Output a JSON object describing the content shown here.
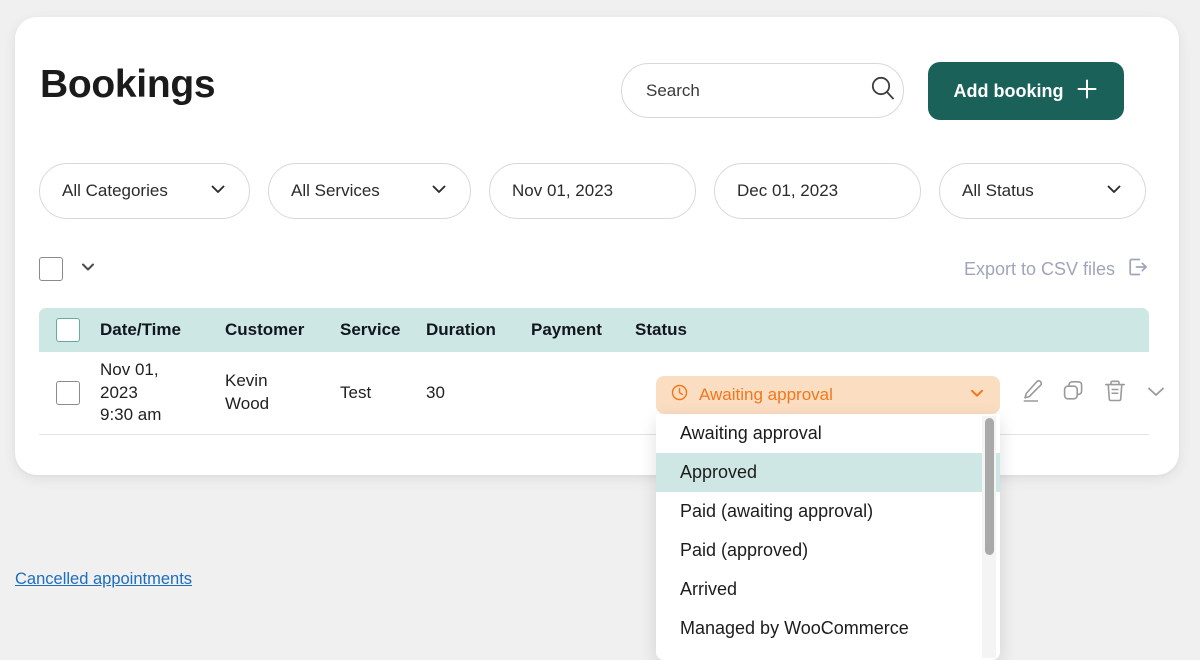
{
  "page": {
    "title": "Bookings",
    "cancelled_link": "Cancelled appointments",
    "accent_teal": "#1a6159",
    "header_bg": "#cce7e4",
    "status_orange": "#f4761a",
    "status_orange_bg": "#fbddc2",
    "link_blue": "#1c6ebd"
  },
  "search": {
    "placeholder": "Search",
    "value": "",
    "icon": "search-icon"
  },
  "toolbar": {
    "add_booking_label": "Add booking",
    "add_booking_icon": "plus-icon",
    "export_label": "Export to CSV files",
    "export_icon": "export-icon"
  },
  "filters": [
    {
      "label": "All Categories",
      "type": "select",
      "has_chevron": true
    },
    {
      "label": "All Services",
      "type": "select",
      "has_chevron": true
    },
    {
      "label": "Nov 01, 2023",
      "type": "date",
      "has_chevron": false
    },
    {
      "label": "Dec 01, 2023",
      "type": "date",
      "has_chevron": false
    },
    {
      "label": "All Status",
      "type": "select",
      "has_chevron": true
    }
  ],
  "table": {
    "columns": [
      "Date/Time",
      "Customer",
      "Service",
      "Duration",
      "Payment",
      "Status"
    ],
    "rows": [
      {
        "datetime": "Nov 01, 2023 9:30 am",
        "date_line1": "Nov 01,",
        "date_line2": "2023",
        "date_line3": "9:30 am",
        "customer_line1": "Kevin",
        "customer_line2": "Wood",
        "customer": "Kevin Wood",
        "service": "Test",
        "duration": "30",
        "payment": "",
        "status": "Awaiting approval",
        "status_icon": "clock-icon"
      }
    ]
  },
  "status_menu": {
    "selected": "Approved",
    "current_value": "Awaiting approval",
    "options": [
      "Awaiting approval",
      "Approved",
      "Paid (awaiting approval)",
      "Paid (approved)",
      "Arrived",
      "Managed by WooCommerce"
    ]
  },
  "row_actions": [
    {
      "name": "edit-icon"
    },
    {
      "name": "duplicate-icon"
    },
    {
      "name": "delete-icon"
    },
    {
      "name": "expand-icon"
    }
  ]
}
